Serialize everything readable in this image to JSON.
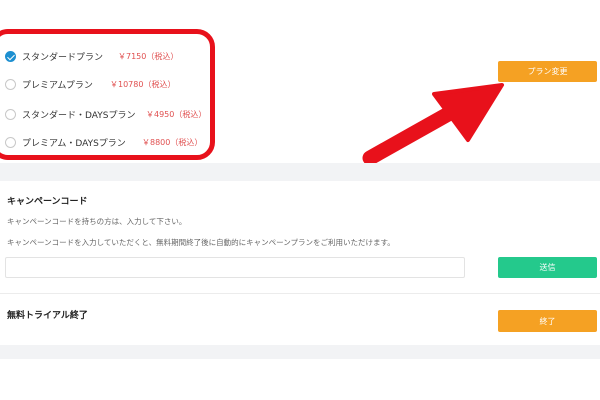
{
  "plans": [
    {
      "name": "スタンダードプラン",
      "price": "￥7150（税込）",
      "selected": true
    },
    {
      "name": "プレミアムプラン",
      "price": "￥10780（税込）",
      "selected": false
    },
    {
      "name": "スタンダード・DAYSプラン",
      "price": "￥4950（税込）",
      "selected": false
    },
    {
      "name": "プレミアム・DAYSプラン",
      "price": "￥8800（税込）",
      "selected": false
    }
  ],
  "plan_change_button": "プラン変更",
  "campaign": {
    "title": "キャンペーンコード",
    "description1": "キャンペーンコードを持ちの方は、入力して下さい。",
    "description2": "キャンペーンコードを入力していただくと、無料期間終了後に自動的にキャンペーンプランをご利用いただけます。",
    "input_value": "",
    "submit_button": "送信"
  },
  "trial": {
    "title": "無料トライアル終了",
    "end_button": "終了"
  },
  "colors": {
    "annotation_red": "#e8111b",
    "orange_button": "#f5a123",
    "green_button": "#24c98c",
    "price_red": "#e05050",
    "radio_checked": "#1d8fd0"
  },
  "icons": {
    "annotation_arrow": "arrow-up-right-icon",
    "radio_checked": "check-icon"
  }
}
